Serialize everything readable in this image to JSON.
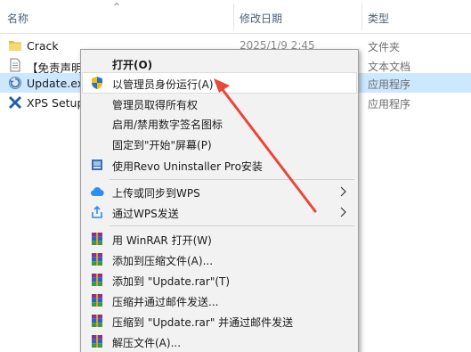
{
  "columns": {
    "name": "名称",
    "date": "修改日期",
    "type": "类型"
  },
  "files": [
    {
      "name": "Crack",
      "date": "2025/1/9 2:45",
      "type": "文件夹",
      "icon": "folder-icon"
    },
    {
      "name": "【免责声明",
      "date": "",
      "type": "文本文档",
      "icon": "text-file-icon"
    },
    {
      "name": "Update.ex",
      "date": "",
      "type": "应用程序",
      "icon": "exe-icon"
    },
    {
      "name": "XPS Setup",
      "date": "",
      "type": "应用程序",
      "icon": "xps-icon"
    }
  ],
  "menu": {
    "open": "打开(O)",
    "run_as_admin": "以管理员身份运行(A)",
    "take_ownership": "管理员取得所有权",
    "signature_icon": "启用/禁用数字签名图标",
    "pin_start": "固定到\"开始\"屏幕(P)",
    "revo": "使用Revo Uninstaller Pro安装",
    "wps_upload": "上传或同步到WPS",
    "wps_send": "通过WPS发送",
    "winrar_open": "用 WinRAR 打开(W)",
    "add_archive": "添加到压缩文件(A)...",
    "add_update_rar": "添加到 \"Update.rar\"(T)",
    "compress_email": "压缩并通过邮件发送...",
    "compress_update_email": "压缩到 \"Update.rar\" 并通过邮件发送",
    "extract": "解压文件(A)..."
  },
  "colors": {
    "selection": "#cce8ff",
    "menu_bg": "#f2f2f2",
    "annotation_arrow": "#e8473a"
  }
}
